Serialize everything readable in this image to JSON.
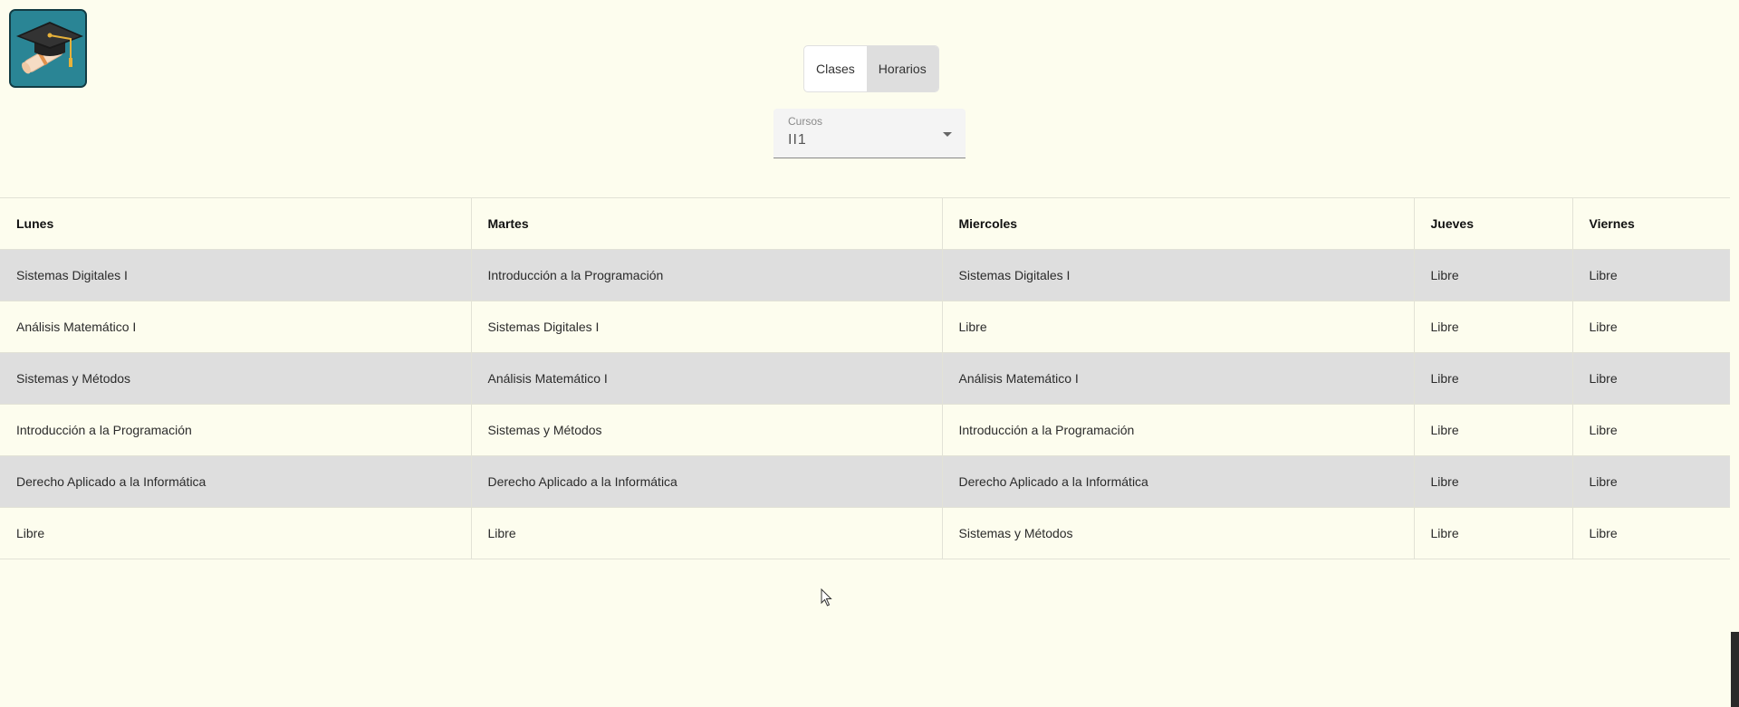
{
  "view_toggle": {
    "clases_label": "Clases",
    "horarios_label": "Horarios"
  },
  "course_select": {
    "label": "Cursos",
    "value": "II1"
  },
  "schedule": {
    "headers": [
      "Lunes",
      "Martes",
      "Miercoles",
      "Jueves",
      "Viernes"
    ],
    "rows": [
      [
        "Sistemas Digitales I",
        "Introducción a la Programación",
        "Sistemas Digitales I",
        "Libre",
        "Libre"
      ],
      [
        "Análisis Matemático I",
        "Sistemas Digitales I",
        "Libre",
        "Libre",
        "Libre"
      ],
      [
        "Sistemas y Métodos",
        "Análisis Matemático I",
        "Análisis Matemático I",
        "Libre",
        "Libre"
      ],
      [
        "Introducción a la Programación",
        "Sistemas y Métodos",
        "Introducción a la Programación",
        "Libre",
        "Libre"
      ],
      [
        "Derecho Aplicado a la Informática",
        "Derecho Aplicado a la Informática",
        "Derecho Aplicado a la Informática",
        "Libre",
        "Libre"
      ],
      [
        "Libre",
        "Libre",
        "Sistemas y Métodos",
        "Libre",
        "Libre"
      ]
    ]
  },
  "icons": {
    "logo": "graduation-cap-diploma-icon",
    "select_arrow": "caret-down-icon",
    "cursor": "mouse-pointer-icon"
  },
  "colors": {
    "background": "#fdfdee",
    "logo_bg": "#2a8595",
    "shaded_row": "#dedede",
    "active_toggle": "#dedede"
  }
}
